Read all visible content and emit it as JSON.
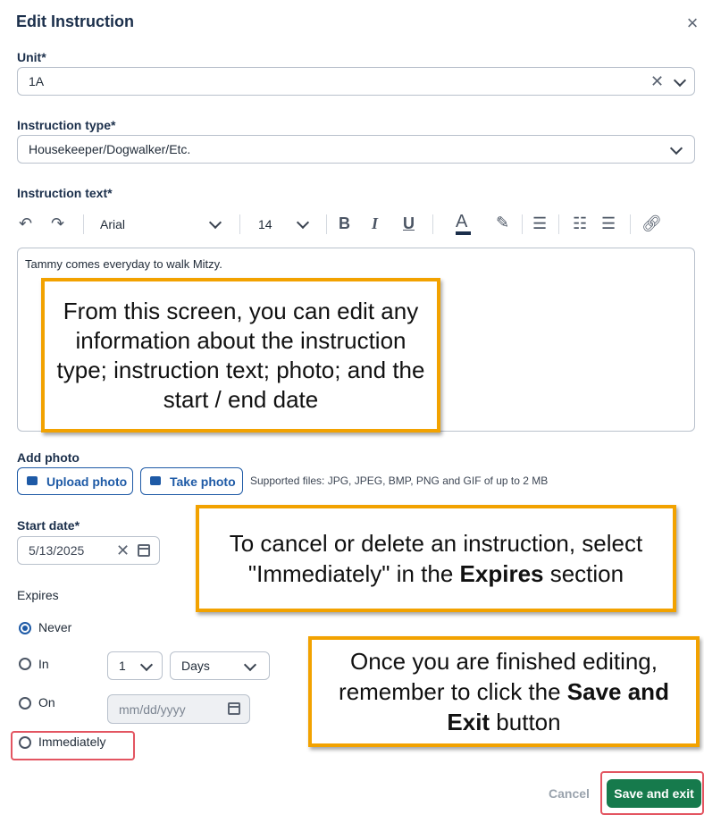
{
  "dialog": {
    "title": "Edit Instruction",
    "close_icon": "close-icon"
  },
  "unit": {
    "label": "Unit*",
    "value": "1A"
  },
  "instruction_type": {
    "label": "Instruction type*",
    "value": "Housekeeper/Dogwalker/Etc."
  },
  "instruction_text": {
    "label": "Instruction text*",
    "toolbar": {
      "font": "Arial",
      "size": "14",
      "bold": "B",
      "italic": "I",
      "underline": "U",
      "color_letter": "A",
      "icons": [
        "undo-icon",
        "redo-icon",
        "bold-icon",
        "italic-icon",
        "underline-icon",
        "text-color-icon",
        "highlight-icon",
        "align-left-icon",
        "bullet-list-icon",
        "numbered-list-icon",
        "link-icon"
      ]
    },
    "content": "Tammy comes everyday to walk Mitzy."
  },
  "photo": {
    "label": "Add photo",
    "upload_label": "Upload photo",
    "take_label": "Take photo",
    "supported": "Supported files: JPG, JPEG, BMP, PNG and GIF of up to 2 MB"
  },
  "start_date": {
    "label": "Start date*",
    "value": "5/13/2025"
  },
  "expires": {
    "label": "Expires",
    "options": {
      "never": "Never",
      "in": "In",
      "on": "On",
      "immediately": "Immediately"
    },
    "selected": "never",
    "in_count": "1",
    "in_unit": "Days",
    "on_placeholder": "mm/dd/yyyy"
  },
  "actions": {
    "cancel": "Cancel",
    "save": "Save and exit"
  },
  "callouts": {
    "edit_info": "From this screen, you can edit any information about the instruction type; instruction text; photo; and the start / end date",
    "cancel_pre": "To cancel or delete an instruction, select \"Immediately\" in the ",
    "cancel_bold": "Expires",
    "cancel_post": " section",
    "save_pre": "Once you are finished editing, remember to click the ",
    "save_bold": "Save and Exit",
    "save_post": " button"
  },
  "colors": {
    "accent": "#1e5aa6",
    "save": "#167a4c",
    "callout_border": "#f2a200",
    "highlight_box": "#e35561"
  }
}
